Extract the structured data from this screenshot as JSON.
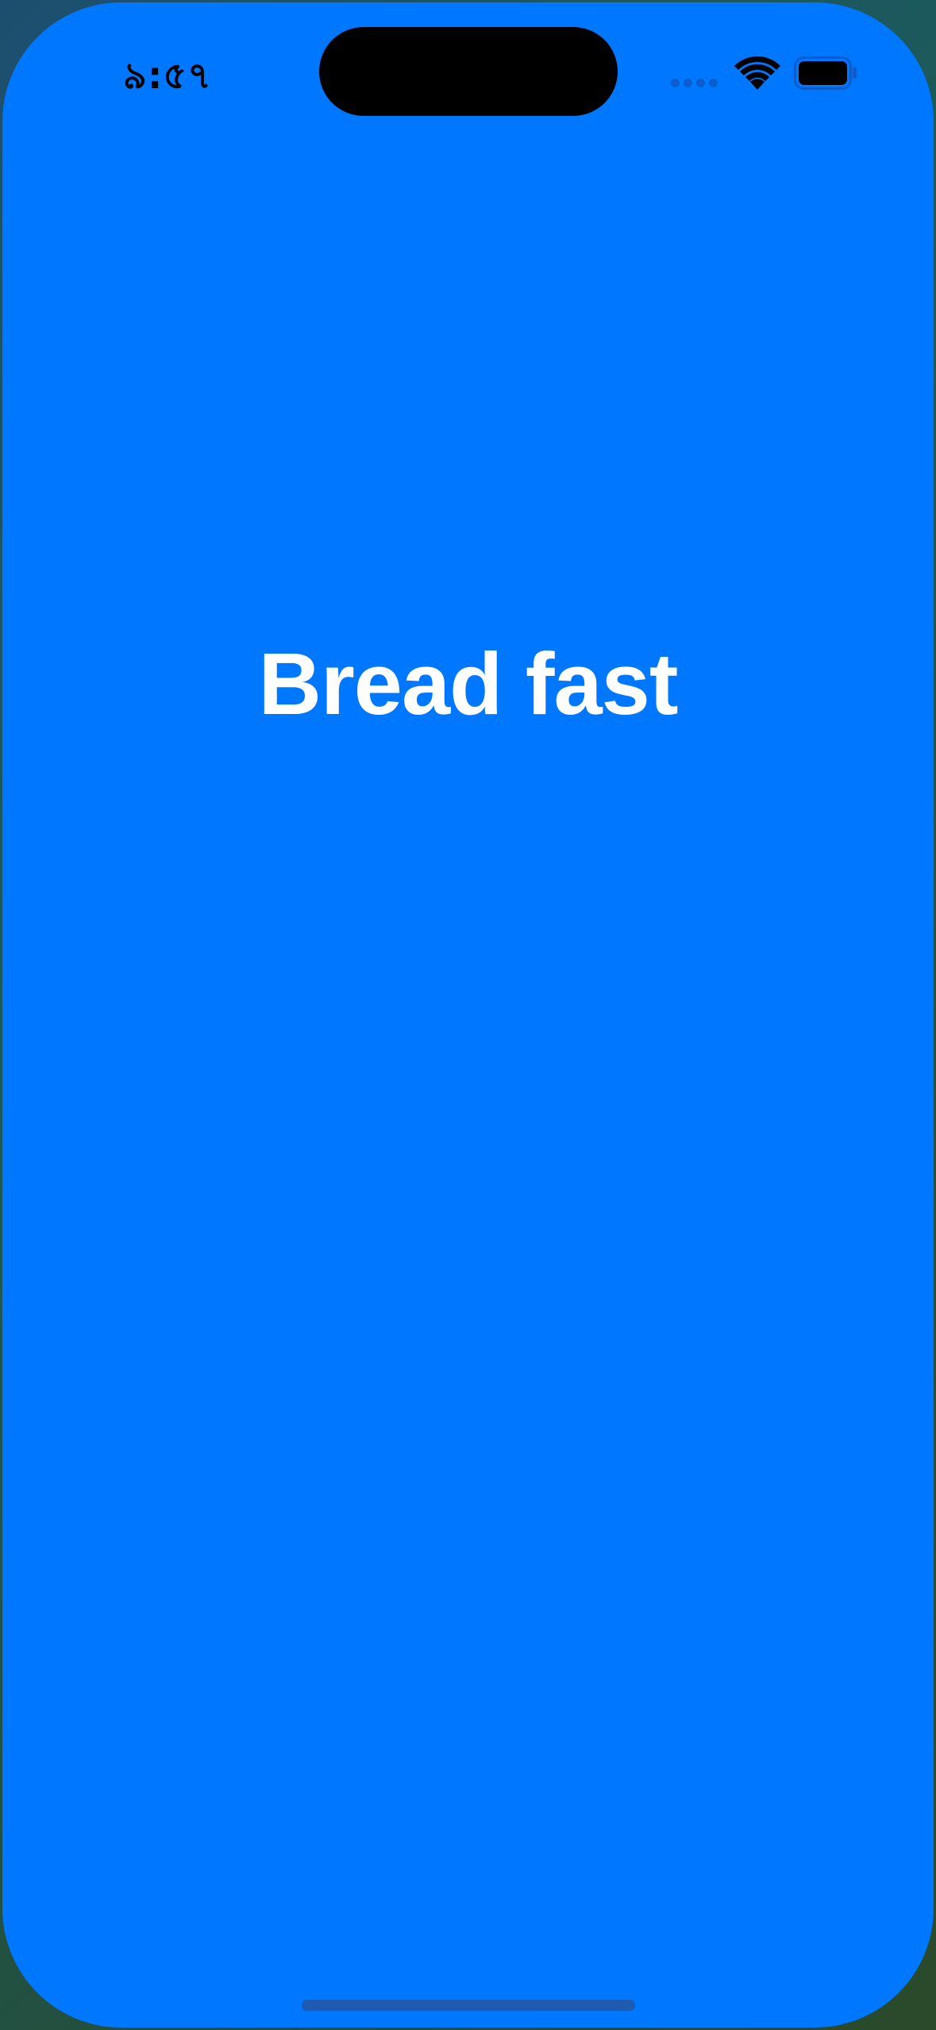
{
  "status_bar": {
    "time": "৯:৫৭",
    "signal_icon": "cellular-signal-icon",
    "wifi_icon": "wifi-icon",
    "battery_icon": "battery-icon"
  },
  "main": {
    "title": "Bread fast"
  },
  "colors": {
    "background": "#0077ff",
    "title_text": "#ffffff",
    "status_text": "#000000"
  }
}
